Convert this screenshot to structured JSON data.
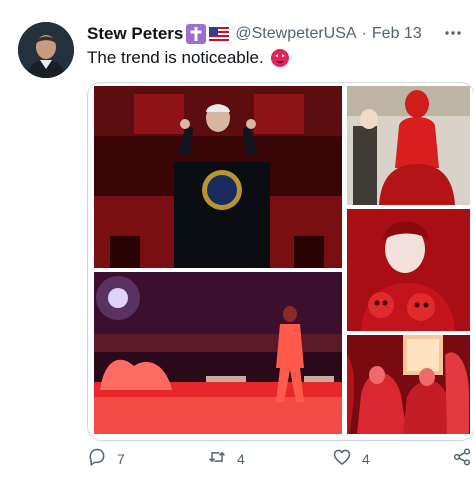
{
  "tweet": {
    "author_name": "Stew Peters",
    "author_handle": "@StewpeterUSA",
    "separator": "·",
    "date": "Feb 13",
    "text": "The trend is noticeable.",
    "icons": {
      "more": "more-options-icon",
      "badge_cross": "cross-icon",
      "badge_flag": "us-flag-icon",
      "emoji": "dishonest-face-emoji-icon"
    }
  },
  "media": {
    "images": [
      {
        "name": "photo-red-speech"
      },
      {
        "name": "photo-red-gown"
      },
      {
        "name": "photo-red-model"
      },
      {
        "name": "photo-red-concert-stage"
      },
      {
        "name": "photo-red-performance"
      }
    ]
  },
  "actions": {
    "reply_count": "7",
    "retweet_count": "4",
    "like_count": "4"
  },
  "colors": {
    "text_primary": "#0f1419",
    "text_secondary": "#536471",
    "border": "#cfd9de",
    "accent_red": "#d0141a"
  }
}
